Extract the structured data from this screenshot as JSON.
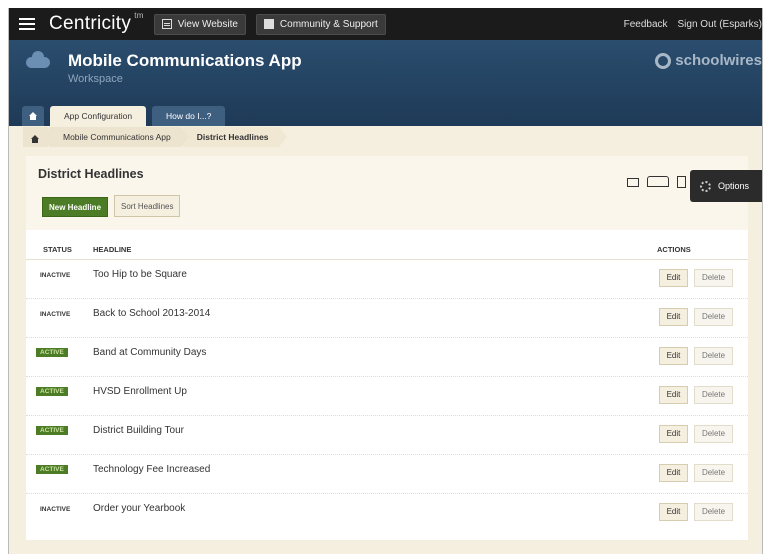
{
  "topbar": {
    "brand": "Centricity",
    "brand_sup": "tm",
    "view_website": "View Website",
    "community_support": "Community & Support",
    "feedback": "Feedback",
    "sign_out": "Sign Out (Esparks)"
  },
  "header": {
    "title": "Mobile Communications App",
    "subtitle": "Workspace",
    "logo_text": "schoolwires"
  },
  "tabs": [
    {
      "label": "App Configuration",
      "active": true
    },
    {
      "label": "How do I...?",
      "active": false
    }
  ],
  "breadcrumb": {
    "items": [
      "Mobile Communications App",
      "District Headlines"
    ]
  },
  "panel": {
    "title": "District Headlines",
    "new_button": "New Headline",
    "sort_button": "Sort Headlines",
    "options_button": "Options"
  },
  "table": {
    "columns": [
      "STATUS",
      "HEADLINE",
      "ACTIONS"
    ],
    "edit_label": "Edit",
    "delete_label": "Delete",
    "rows": [
      {
        "status": "INACTIVE",
        "headline": "Too Hip to be Square"
      },
      {
        "status": "INACTIVE",
        "headline": "Back to School 2013-2014"
      },
      {
        "status": "ACTIVE",
        "headline": "Band at Community Days"
      },
      {
        "status": "ACTIVE",
        "headline": "HVSD Enrollment Up"
      },
      {
        "status": "ACTIVE",
        "headline": "District Building Tour"
      },
      {
        "status": "ACTIVE",
        "headline": "Technology Fee Increased"
      },
      {
        "status": "INACTIVE",
        "headline": "Order your Yearbook"
      }
    ]
  },
  "colors": {
    "topbar": "#1b1b1b",
    "hero": "#1e3a57",
    "active_badge": "#4c7c25",
    "page_bg": "#f5efdf"
  }
}
